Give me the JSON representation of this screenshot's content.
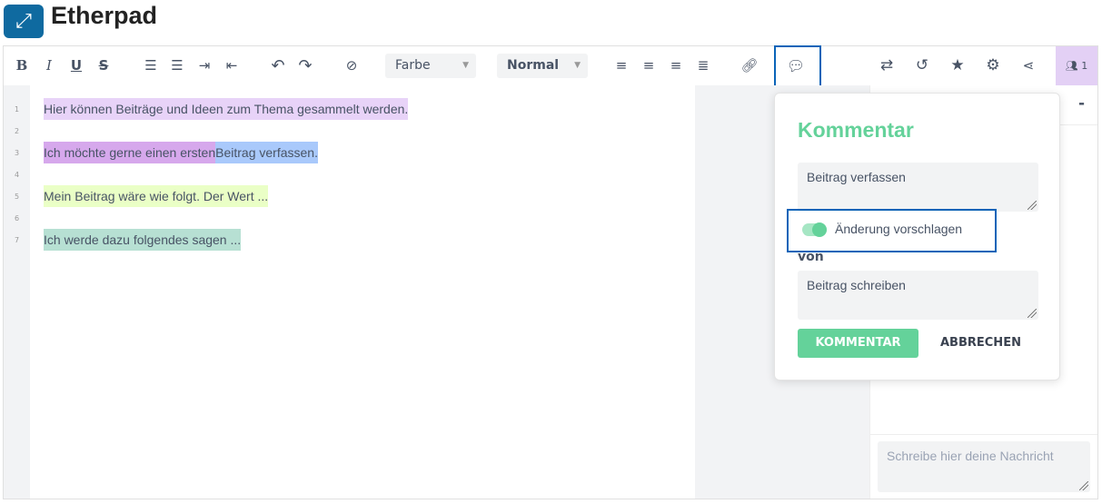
{
  "app": {
    "title": "Etherpad",
    "logo_icon": "expand-arrows-icon"
  },
  "toolbar": {
    "bold": "B",
    "italic": "I",
    "underline": "U",
    "strike": "S",
    "color_select": "Farbe",
    "style_select": "Normal",
    "users_count": "1"
  },
  "editor": {
    "lines": [
      {
        "num": "1",
        "text": "Hier können Beiträge und Ideen zum Thema gesammelt werden.",
        "color": "#e8d3f8"
      },
      {
        "num": "2",
        "text": ""
      },
      {
        "num": "3",
        "text": "Ich möchte gerne einen ersten ",
        "text2": "Beitrag verfassen.",
        "color": "#d6a8ec",
        "color2": "#a9c9fb"
      },
      {
        "num": "4",
        "text": ""
      },
      {
        "num": "5",
        "text": "Mein Beitrag wäre wie folgt. Der Wert ...",
        "color": "#eaffc6"
      },
      {
        "num": "6",
        "text": ""
      },
      {
        "num": "7",
        "text": "Ich werde dazu folgendes sagen ...",
        "color": "#b7e0d3"
      }
    ]
  },
  "comment": {
    "title": "Kommentar",
    "comment_text": "Beitrag verfassen",
    "suggest_label": "Änderung vorschlagen",
    "suggest_on": true,
    "from_label": "von",
    "suggest_text": "Beitrag schreiben",
    "submit": "KOMMENTAR",
    "cancel": "ABBRECHEN",
    "accent": "#64d29a"
  },
  "chat": {
    "minimize": "-",
    "placeholder": "Schreibe hier deine Nachricht"
  }
}
